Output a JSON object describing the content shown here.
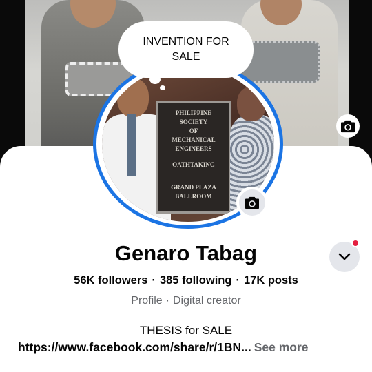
{
  "cover": {
    "camera_icon": "camera-icon"
  },
  "bubble": {
    "text": "INVENTION FOR SALE"
  },
  "avatar": {
    "plaque_lines": [
      "PHILIPPINE",
      "SOCIETY",
      "OF",
      "MECHANICAL",
      "ENGINEERS",
      "OATHTAKING",
      "GRAND PLAZA",
      "BALLROOM"
    ],
    "camera_icon": "camera-icon"
  },
  "profile": {
    "name": "Genaro Tabag",
    "followers": "56K followers",
    "following": "385 following",
    "posts": "17K posts",
    "separator": "·",
    "type": "Profile",
    "category": "Digital creator"
  },
  "bio": {
    "line1": "THESIS for SALE",
    "link": "https://www.facebook.com/share/r/1BN...",
    "see_more": "See more"
  },
  "more_button": {
    "icon": "chevron-down-icon"
  },
  "colors": {
    "accent": "#1b74e4",
    "notification": "#e41e3f",
    "secondary_text": "#65676b",
    "button_bg": "#e4e6eb"
  }
}
